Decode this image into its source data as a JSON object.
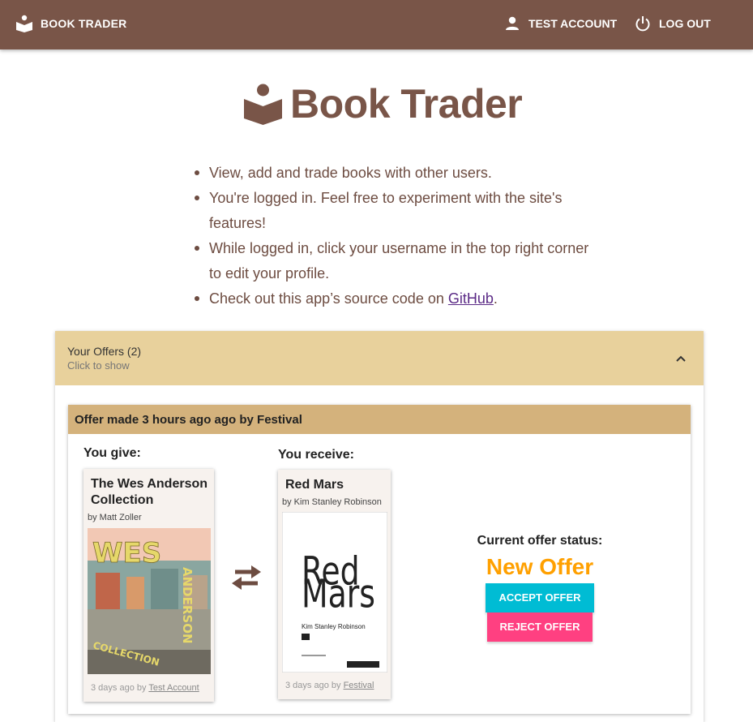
{
  "nav": {
    "brand": "BOOK TRADER",
    "account": "TEST ACCOUNT",
    "logout": "LOG OUT"
  },
  "hero": {
    "title": "Book Trader"
  },
  "intro": {
    "item1": "View, add and trade books with other users.",
    "item2": "You're logged in. Feel free to experiment with the site's features!",
    "item3": "While logged in, click your username in the top right corner to edit your profile.",
    "item4_prefix": "Check out this app’s source code on ",
    "item4_link": "GitHub",
    "item4_suffix": "."
  },
  "offers": {
    "title": "Your Offers (2)",
    "subtitle": "Click to show",
    "offer": {
      "header": "Offer made 3 hours ago ago by Festival",
      "give_label": "You give:",
      "receive_label": "You receive:",
      "give_book": {
        "title": "The Wes Anderson Collection",
        "author": "by Matt Zoller",
        "added": "3 days ago by ",
        "owner": "Test Account",
        "cover_text_1": "WES",
        "cover_text_2": "ANDERSON",
        "cover_text_3": "COLLECTION"
      },
      "receive_book": {
        "title": "Red Mars",
        "author": "by Kim Stanley Robinson",
        "added": "3 days ago by ",
        "owner": "Festival",
        "cover_title_1": "Red",
        "cover_title_2": "Mars",
        "cover_author": "Kim Stanley Robinson"
      },
      "status_label": "Current offer status:",
      "status_value": "New Offer",
      "accept": "ACCEPT OFFER",
      "reject": "REJECT OFFER"
    }
  },
  "colors": {
    "navbar": "#795548",
    "panel_header": "#e8d19c",
    "offer_header": "#d4b27c",
    "status": "#ffa000",
    "accept": "#00bcd4",
    "reject": "#ff4081"
  }
}
